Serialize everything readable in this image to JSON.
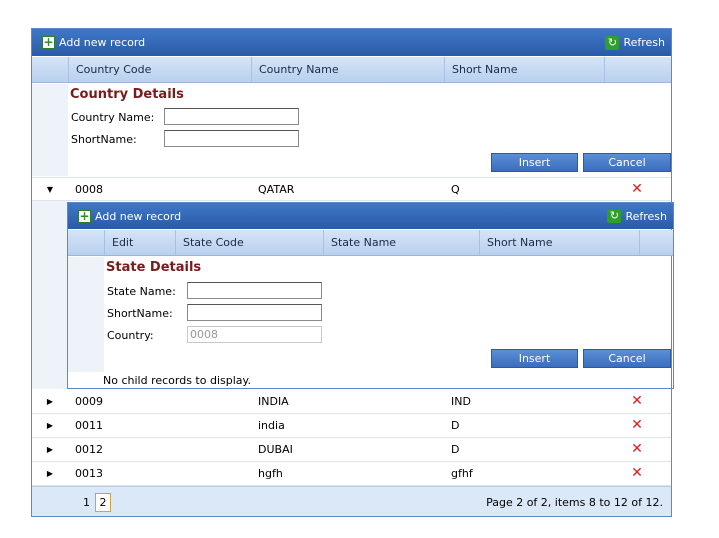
{
  "toolbar": {
    "add_label": "Add new record",
    "refresh_label": "Refresh"
  },
  "columns": {
    "country_code": "Country Code",
    "country_name": "Country Name",
    "short_name": "Short Name"
  },
  "country_form": {
    "title": "Country Details",
    "name_label": "Country Name:",
    "short_label": "ShortName:",
    "name_value": "",
    "short_value": "",
    "insert_label": "Insert",
    "cancel_label": "Cancel"
  },
  "expanded_row": {
    "code": "0008",
    "name": "QATAR",
    "short": "Q"
  },
  "child": {
    "add_label": "Add new record",
    "refresh_label": "Refresh",
    "columns": {
      "edit": "Edit",
      "state_code": "State Code",
      "state_name": "State Name",
      "short_name": "Short Name"
    },
    "form": {
      "title": "State Details",
      "name_label": "State Name:",
      "short_label": "ShortName:",
      "country_label": "Country:",
      "country_value": "0008",
      "insert_label": "Insert",
      "cancel_label": "Cancel"
    },
    "empty_text": "No child records to display."
  },
  "rows": [
    {
      "code": "0009",
      "name": "INDIA",
      "short": "IND"
    },
    {
      "code": "0011",
      "name": "india",
      "short": "D"
    },
    {
      "code": "0012",
      "name": "DUBAI",
      "short": "D"
    },
    {
      "code": "0013",
      "name": "hgfh",
      "short": "gfhf"
    }
  ],
  "pager": {
    "pages": [
      "1",
      "2"
    ],
    "current": "2",
    "info": "Page 2 of 2, items 8 to 12 of 12."
  },
  "colors": {
    "header_blue": "#2a5aa8",
    "title_red": "#7a1a1a",
    "delete_red": "#d42020"
  }
}
